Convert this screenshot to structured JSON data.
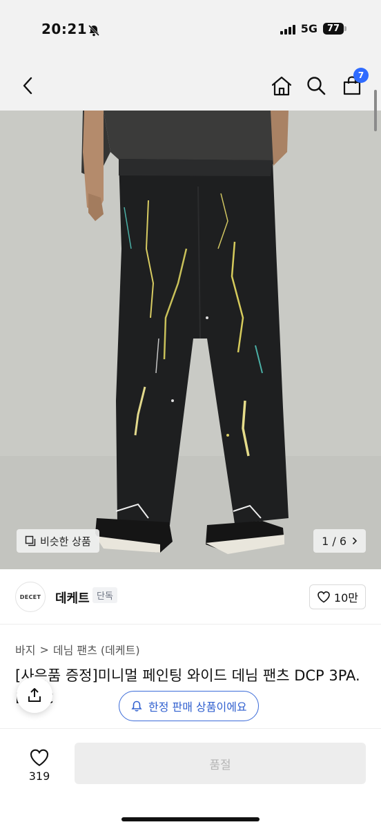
{
  "status_bar": {
    "time": "20:21",
    "network": "5G",
    "battery": "77",
    "icons": [
      "bell-slash-icon",
      "signal-icon",
      "battery-icon"
    ]
  },
  "header": {
    "icons": [
      "back-icon",
      "home-icon",
      "search-icon",
      "cart-icon"
    ],
    "cart_count": "7"
  },
  "gallery": {
    "similar_label": "비슷한 상품",
    "page_indicator": "1 / 6",
    "current_page": 1,
    "total_pages": 6
  },
  "brand": {
    "logo_text": "DECET",
    "name": "데케트",
    "tag": "단독",
    "likes": "10만"
  },
  "breadcrumb": {
    "items": [
      "바지",
      "데님 팬츠 (데케트)"
    ],
    "separator": ">"
  },
  "product": {
    "title": "[사은품 증정]미니멀 페인팅 와이드 데님 팬츠 DCP  3PA.BLAC"
  },
  "notice": {
    "limited_label": "한정 판매 상품이에요"
  },
  "bottom": {
    "wish_count": "319",
    "soldout_label": "품절"
  },
  "colors": {
    "accent": "#2f6bff",
    "pill_border": "#3b6bd8",
    "soldout_bg": "#ededed",
    "soldout_text": "#b5b5b5",
    "header_bg": "#f2f2f2"
  }
}
